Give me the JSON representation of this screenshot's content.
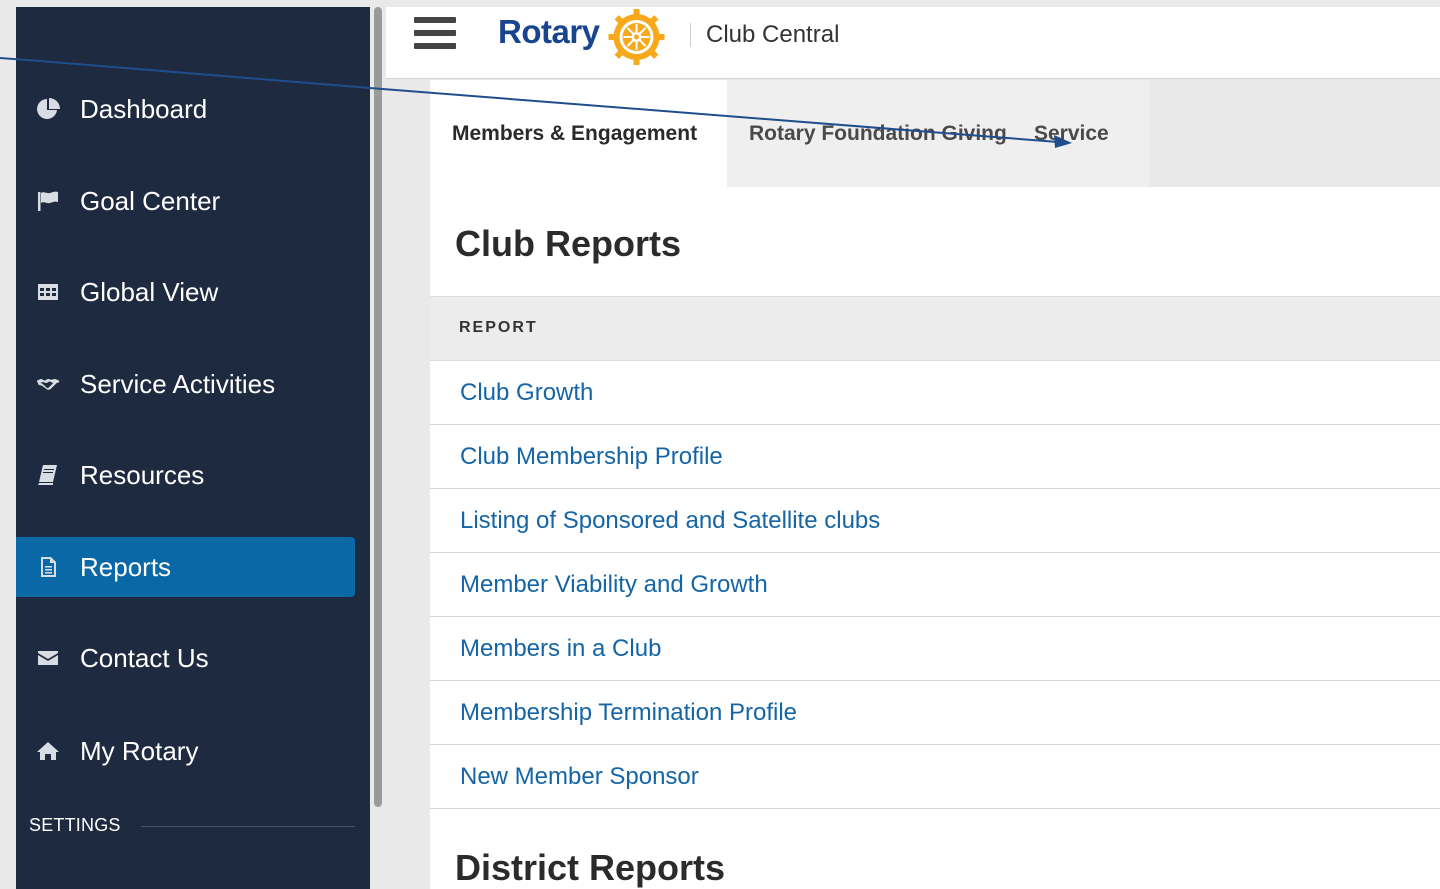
{
  "sidebar": {
    "items": [
      {
        "label": "Dashboard",
        "icon": "pie-chart-icon"
      },
      {
        "label": "Goal Center",
        "icon": "flag-icon"
      },
      {
        "label": "Global View",
        "icon": "grid-table-icon"
      },
      {
        "label": "Service Activities",
        "icon": "handshake-icon"
      },
      {
        "label": "Resources",
        "icon": "book-icon"
      },
      {
        "label": "Reports",
        "icon": "document-icon",
        "active": true
      },
      {
        "label": "Contact Us",
        "icon": "envelope-icon"
      },
      {
        "label": "My Rotary",
        "icon": "home-icon"
      }
    ],
    "settings_label": "SETTINGS"
  },
  "header": {
    "logo_text": "Rotary",
    "app_title": "Club Central"
  },
  "tabs": [
    {
      "label": "Members & Engagement",
      "active": true
    },
    {
      "label": "Rotary Foundation Giving",
      "active": false
    },
    {
      "label": "Service",
      "active": false
    }
  ],
  "club_reports": {
    "title": "Club Reports",
    "column_header": "REPORT",
    "rows": [
      "Club Growth",
      "Club Membership Profile",
      "Listing of Sponsored and Satellite clubs",
      "Member Viability and Growth",
      "Members in a Club",
      "Membership Termination Profile",
      "New Member Sponsor"
    ]
  },
  "district_reports": {
    "title": "District Reports"
  },
  "colors": {
    "sidebar_bg": "#1e2a3f",
    "active_item": "#0b68a6",
    "link": "#1565a6",
    "brand_blue": "#17458f",
    "brand_gold": "#f7a81b",
    "annotation_arrow": "#1f4e8c"
  }
}
